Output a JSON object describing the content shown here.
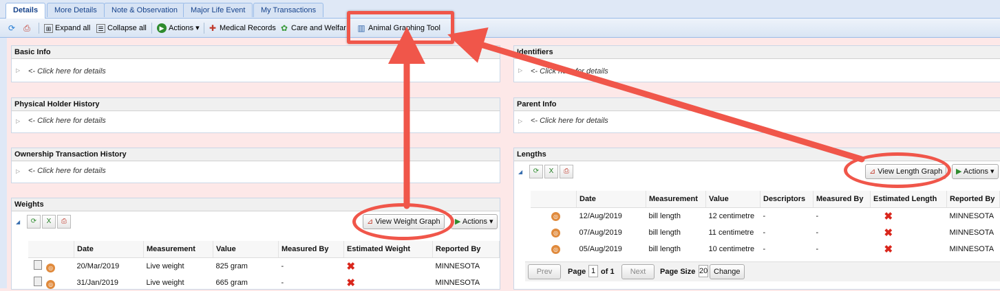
{
  "tabs": [
    "Details",
    "More Details",
    "Note & Observation",
    "Major Life Event",
    "My Transactions"
  ],
  "toolbar": {
    "expand_all": "Expand all",
    "collapse_all": "Collapse all",
    "actions": "Actions",
    "medical_records": "Medical Records",
    "care_welfare": "Care and Welfar",
    "animal_graphing_tool": "Animal Graphing Tool"
  },
  "panels": {
    "basic_info": "Basic Info",
    "identifiers": "Identifiers",
    "physical_holder_history": "Physical Holder History",
    "parent_info": "Parent Info",
    "ownership_transaction_history": "Ownership Transaction History",
    "lengths": "Lengths",
    "weights": "Weights",
    "click_hint": "<- Click here for details",
    "identifiers_hint": "<- Click here for details"
  },
  "weights": {
    "view_graph": "View Weight Graph",
    "actions": "Actions",
    "columns": [
      "Date",
      "Measurement",
      "Value",
      "Measured By",
      "Estimated Weight",
      "Reported By"
    ],
    "rows": [
      {
        "date": "20/Mar/2019",
        "measurement": "Live weight",
        "value": "825 gram",
        "measured_by": "-",
        "reported_by": "MINNESOTA"
      },
      {
        "date": "31/Jan/2019",
        "measurement": "Live weight",
        "value": "665 gram",
        "measured_by": "-",
        "reported_by": "MINNESOTA"
      }
    ]
  },
  "lengths": {
    "view_graph": "View Length Graph",
    "actions": "Actions",
    "columns": [
      "Date",
      "Measurement",
      "Value",
      "Descriptors",
      "Measured By",
      "Estimated Length",
      "Reported By"
    ],
    "rows": [
      {
        "date": "12/Aug/2019",
        "measurement": "bill length",
        "value": "12 centimetre",
        "descriptors": "-",
        "measured_by": "-",
        "reported_by": "MINNESOTA"
      },
      {
        "date": "07/Aug/2019",
        "measurement": "bill length",
        "value": "11 centimetre",
        "descriptors": "-",
        "measured_by": "-",
        "reported_by": "MINNESOTA"
      },
      {
        "date": "05/Aug/2019",
        "measurement": "bill length",
        "value": "10 centimetre",
        "descriptors": "-",
        "measured_by": "-",
        "reported_by": "MINNESOTA"
      }
    ],
    "pager": {
      "prev": "Prev",
      "page_label": "Page",
      "page_value": "1",
      "of": "of 1",
      "next": "Next",
      "page_size_label": "Page Size",
      "page_size_value": "20",
      "change": "Change"
    }
  },
  "colors": {
    "annotation": "#f0564a",
    "tab_text": "#15428b"
  }
}
